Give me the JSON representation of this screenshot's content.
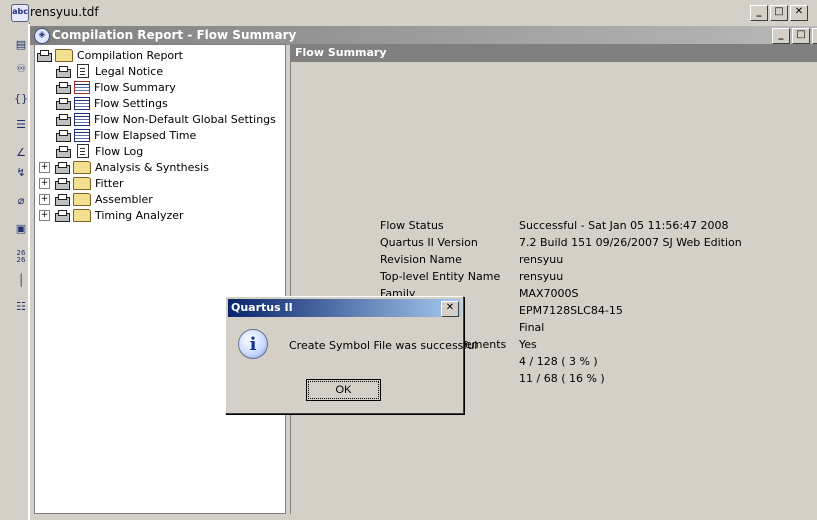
{
  "outer_window": {
    "title": "rensyuu.tdf",
    "icon": "abc-file-icon"
  },
  "report_window": {
    "title": "Compilation Report - Flow Summary"
  },
  "tree": {
    "root": {
      "label": "Compilation Report"
    },
    "items": [
      {
        "label": "Legal Notice",
        "icon": "document"
      },
      {
        "label": "Flow Summary",
        "icon": "table-red"
      },
      {
        "label": "Flow Settings",
        "icon": "table"
      },
      {
        "label": "Flow Non-Default Global Settings",
        "icon": "table"
      },
      {
        "label": "Flow Elapsed Time",
        "icon": "table"
      },
      {
        "label": "Flow Log",
        "icon": "document"
      }
    ],
    "folders": [
      {
        "label": "Analysis & Synthesis"
      },
      {
        "label": "Fitter"
      },
      {
        "label": "Assembler"
      },
      {
        "label": "Timing Analyzer"
      }
    ]
  },
  "flow_summary": {
    "header": "Flow Summary",
    "rows": [
      {
        "key": "Flow Status",
        "value": "Successful - Sat Jan 05 11:56:47 2008"
      },
      {
        "key": "Quartus II Version",
        "value": "7.2 Build 151 09/26/2007 SJ Web Edition"
      },
      {
        "key": "Revision Name",
        "value": "rensyuu"
      },
      {
        "key": "Top-level Entity Name",
        "value": "rensyuu"
      },
      {
        "key": "Family",
        "value": "MAX7000S"
      },
      {
        "key": "Device",
        "value": "EPM7128SLC84-15"
      },
      {
        "key": "",
        "value": "Final"
      },
      {
        "key": "ements",
        "value": "Yes"
      },
      {
        "key": "",
        "value": "4 / 128 ( 3 % )"
      },
      {
        "key": "",
        "value": "11 / 68 ( 16 % )"
      }
    ]
  },
  "dialog": {
    "title": "Quartus II",
    "message": "Create Symbol File was successful",
    "ok_label": "OK",
    "close_glyph": "✕"
  },
  "caption_buttons": {
    "minimize": "_",
    "maximize": "□",
    "close": "✕"
  }
}
